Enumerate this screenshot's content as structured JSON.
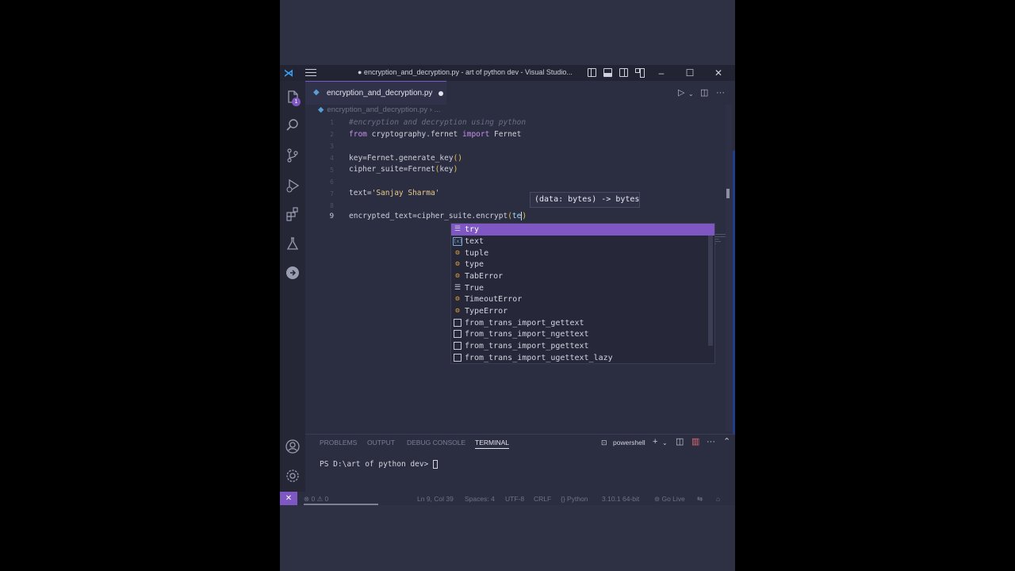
{
  "window": {
    "title": "● encryption_and_decryption.py - art of python dev - Visual Studio..."
  },
  "tab": {
    "filename": "encryption_and_decryption.py",
    "modified": true
  },
  "breadcrumb": {
    "file": "encryption_and_decryption.py",
    "more": "..."
  },
  "activity": {
    "explorer_badge": "1"
  },
  "editor": {
    "lines": [
      {
        "num": "1",
        "text": "#encryption and decryption using python"
      },
      {
        "num": "2",
        "text": "from cryptography.fernet import Fernet"
      },
      {
        "num": "3",
        "text": ""
      },
      {
        "num": "4",
        "text": "key=Fernet.generate_key()"
      },
      {
        "num": "5",
        "text": "cipher_suite=Fernet(key)"
      },
      {
        "num": "6",
        "text": ""
      },
      {
        "num": "7",
        "text": "text='Sanjay Sharma'"
      },
      {
        "num": "8",
        "text": ""
      },
      {
        "num": "9",
        "text": "encrypted_text=cipher_suite.encrypt(te)"
      }
    ],
    "active_line": "9"
  },
  "hover": {
    "signature": "(data: bytes) -> bytes"
  },
  "suggestions": [
    {
      "kind": "keyword",
      "label": "try",
      "selected": true
    },
    {
      "kind": "variable",
      "label": "text",
      "selected": false
    },
    {
      "kind": "class",
      "label": "tuple",
      "selected": false
    },
    {
      "kind": "class",
      "label": "type",
      "selected": false
    },
    {
      "kind": "class",
      "label": "TabError",
      "selected": false
    },
    {
      "kind": "keyword",
      "label": "True",
      "selected": false
    },
    {
      "kind": "class",
      "label": "TimeoutError",
      "selected": false
    },
    {
      "kind": "class",
      "label": "TypeError",
      "selected": false
    },
    {
      "kind": "text",
      "label": "from_trans_import_gettext",
      "selected": false
    },
    {
      "kind": "text",
      "label": "from_trans_import_ngettext",
      "selected": false
    },
    {
      "kind": "text",
      "label": "from_trans_import_pgettext",
      "selected": false
    },
    {
      "kind": "text",
      "label": "from_trans_import_ugettext_lazy",
      "selected": false
    }
  ],
  "panel": {
    "tabs": [
      "PROBLEMS",
      "OUTPUT",
      "DEBUG CONSOLE",
      "TERMINAL"
    ],
    "active_tab": "TERMINAL",
    "terminal_name": "powershell",
    "prompt": "PS D:\\art of python dev> "
  },
  "statusbar": {
    "problems": "0 ⚠ 0",
    "position": "Ln 9, Col 39",
    "spaces": "Spaces: 4",
    "encoding": "UTF-8",
    "eol": "CRLF",
    "language": "Python",
    "interpreter": "3.10.1 64-bit",
    "live": "Go Live"
  },
  "colors": {
    "accent": "#7e57c2",
    "background": "#2b2d40",
    "vscode_logo": "#3aa0f3"
  },
  "icons": {
    "activity": [
      "files-icon",
      "search-icon",
      "source-control-icon",
      "run-debug-icon",
      "extensions-icon",
      "testing-icon",
      "gitlens-icon",
      "account-icon",
      "settings-gear-icon"
    ]
  }
}
